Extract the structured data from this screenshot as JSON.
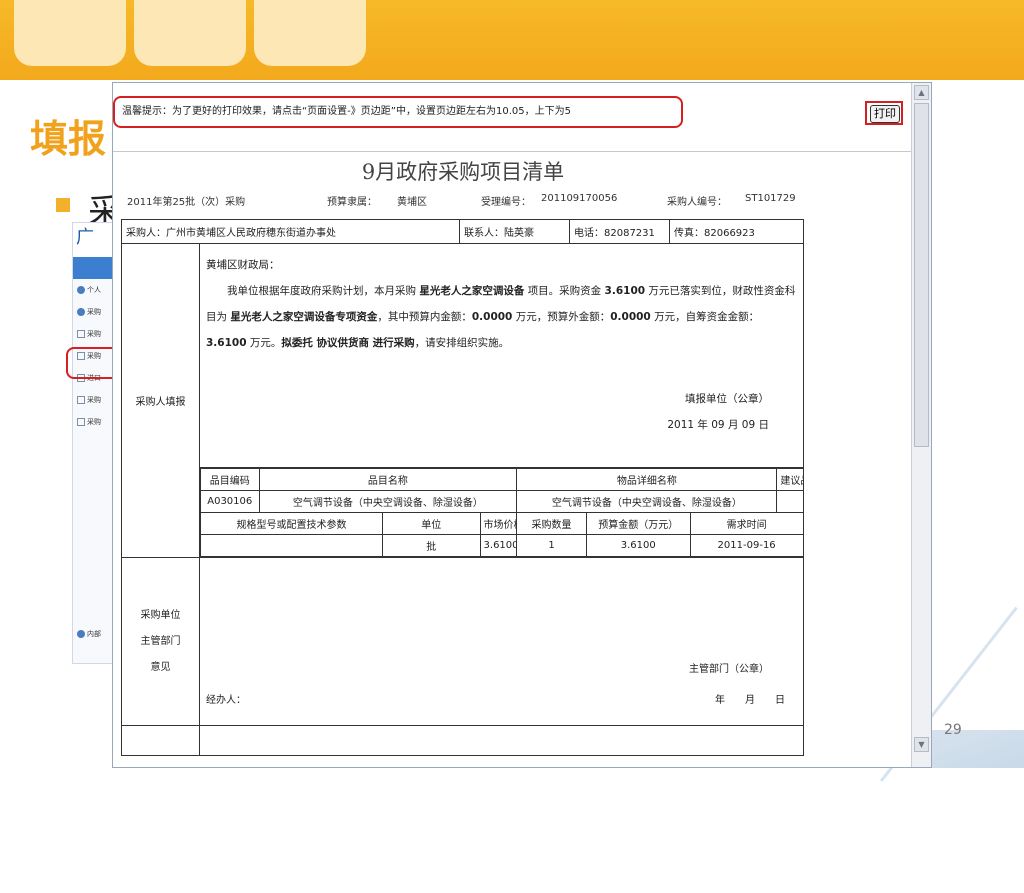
{
  "slide": {
    "title_fragment": "填报",
    "bullet_fragment": "采",
    "page_number": "29",
    "colors": {
      "banner": "#f3a91c",
      "title": "#f0a21d",
      "highlight_red": "#d42020"
    }
  },
  "background_screenshot": {
    "header_fragment": "广",
    "menu_items": [
      "个人",
      "采购",
      "采购",
      "采购",
      "进口",
      "采购",
      "采购"
    ],
    "footer_item": "内部"
  },
  "window": {
    "notice": "温馨提示：为了更好的打印效果，请点击“页面设置-》页边距”中，设置页边距左右为10.05，上下为5",
    "print_button": "打印",
    "scroll_up_icon": "chevron-up-icon",
    "scroll_down_icon": "chevron-down-icon"
  },
  "form": {
    "title": "9月政府采购项目清单",
    "meta": {
      "batch": "2011年第25批（次）采购",
      "budget_label": "预算隶属：",
      "budget_value": "黄埔区",
      "accept_label": "受理编号：",
      "accept_value": "201109170056",
      "buyer_no_label": "采购人编号：",
      "buyer_no_value": "ST101729"
    },
    "buyer": "采购人：广州市黄埔区人民政府穗东街道办事处",
    "contact": "联系人：陆英豪",
    "phone": "电话：82087231",
    "fax": "传真：82066923",
    "section1_label": "采购人填报",
    "letter": {
      "greeting": "黄埔区财政局：",
      "t1": "我单位根据年度政府采购计划，本月采购",
      "project": "星光老人之家空调设备",
      "t2": "项目。采购资金",
      "amount": "3.6100",
      "t3": "万元已落实到位，财政性资金科目为",
      "fund": "星光老人之家空调设备专项资金",
      "t4": "，其中预算内金额：",
      "in_budget": "0.0000",
      "t5": "万元，预算外金额：",
      "out_budget": "0.0000",
      "t6": "万元，自筹资金金额：",
      "self_fund": "3.6100",
      "t7": "万元。",
      "entrust": "拟委托 协议供货商 进行采购",
      "t8": "，请安排组织实施。"
    },
    "seal_unit": "填报单位（公章）",
    "seal_date": "2011 年 09 月 09 日",
    "items_header": [
      "品目编码",
      "品目名称",
      "物品详细名称",
      "建议品牌"
    ],
    "items_row": [
      "A030106",
      "空气调节设备（中央空调设备、除湿设备）",
      "空气调节设备（中央空调设备、除湿设备）",
      ""
    ],
    "specs_header": [
      "规格型号或配置技术参数",
      "单位",
      "市场价格（万元）",
      "采购数量",
      "预算金额（万元）",
      "需求时间"
    ],
    "specs_row": [
      "",
      "批",
      "3.6100",
      "1",
      "3.6100",
      "2011-09-16"
    ],
    "section2_label_1": "采购单位",
    "section2_label_2": "主管部门",
    "section2_label_3": "意见",
    "dept_seal": "主管部门（公章）",
    "handler": "经办人：",
    "ymd": "年　　月　　日"
  }
}
